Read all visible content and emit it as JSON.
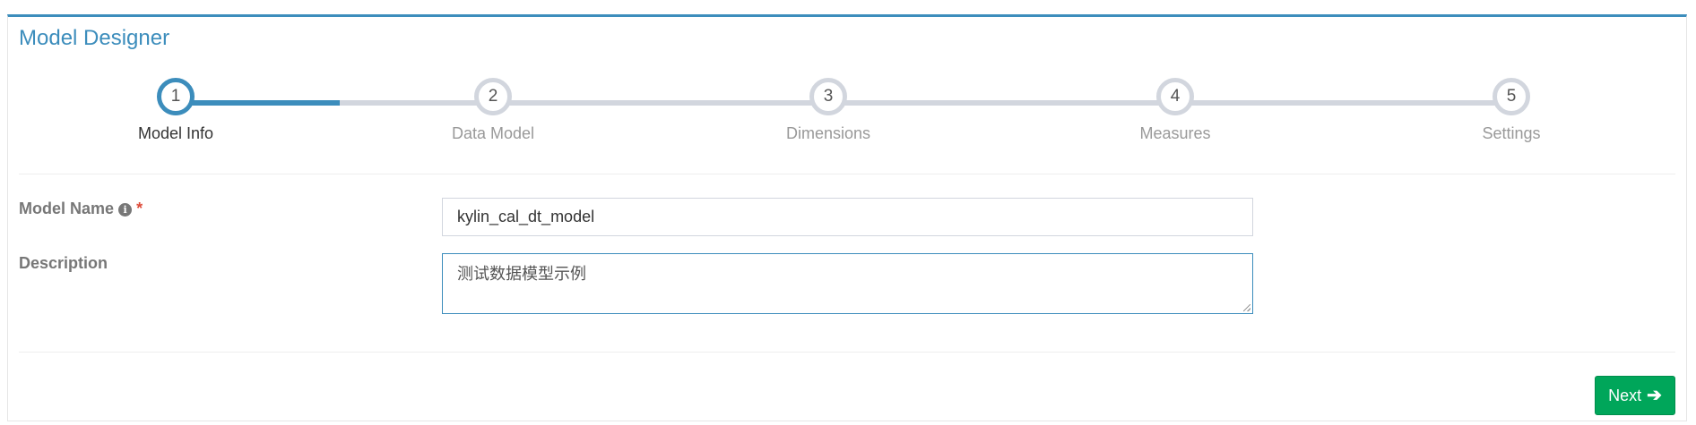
{
  "title": "Model Designer",
  "steps": [
    {
      "number": "1",
      "label": "Model Info"
    },
    {
      "number": "2",
      "label": "Data Model"
    },
    {
      "number": "3",
      "label": "Dimensions"
    },
    {
      "number": "4",
      "label": "Measures"
    },
    {
      "number": "5",
      "label": "Settings"
    }
  ],
  "active_step": 1,
  "form": {
    "model_name_label": "Model Name",
    "required_mark": "*",
    "model_name_value": "kylin_cal_dt_model",
    "description_label": "Description",
    "description_value": "测试数据模型示例"
  },
  "footer": {
    "next_label": "Next",
    "next_icon": "arrow-right-icon"
  },
  "colors": {
    "accent": "#3c8dbc",
    "success": "#00a65a",
    "required": "#dd4b39",
    "track": "#d2d6de"
  }
}
